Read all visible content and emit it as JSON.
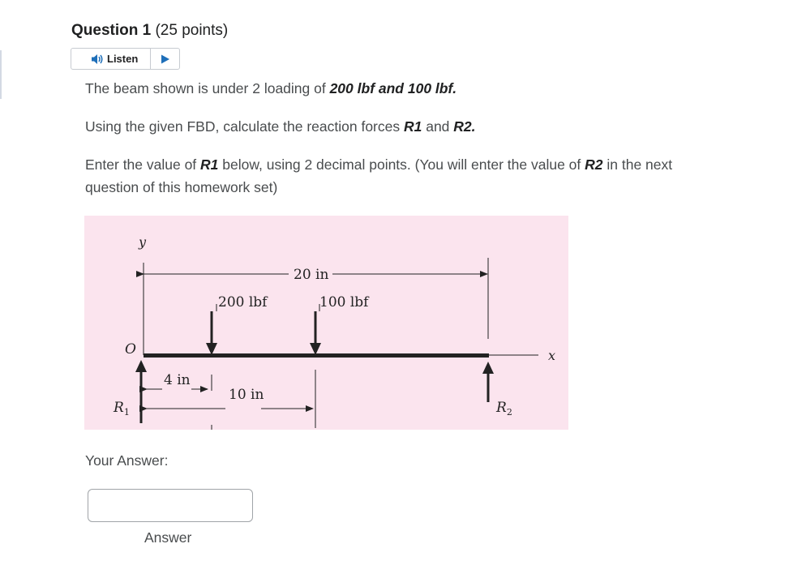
{
  "question": {
    "title_strong": "Question 1",
    "title_rest": " (25 points)"
  },
  "listen": {
    "label": "Listen",
    "speaker_icon": "speaker-icon",
    "play_icon": "play-icon"
  },
  "paragraphs": {
    "p1_a": "The beam shown is under 2 loading of ",
    "p1_b": "200 lbf and 100 lbf.",
    "p2_a": "Using the given FBD, calculate the reaction forces ",
    "p2_b": "R1",
    "p2_c": " and ",
    "p2_d": "R2.",
    "p3_a": "Enter the value of ",
    "p3_b": "R1",
    "p3_c": " below, using 2 decimal points. (You will enter the value of ",
    "p3_d": "R2",
    "p3_e": " in the next question of this homework set)"
  },
  "figure": {
    "background": "#fbe4ee",
    "y_axis": "y",
    "x_axis": "x",
    "origin": "O",
    "dim_total": "20 in",
    "load1": "200 lbf",
    "load2": "100 lbf",
    "dim_4": "4 in",
    "dim_10": "10 in",
    "r1": "R",
    "r1_sub": "1",
    "r2": "R",
    "r2_sub": "2"
  },
  "answer": {
    "label": "Your Answer:",
    "value": "",
    "caption": "Answer"
  }
}
